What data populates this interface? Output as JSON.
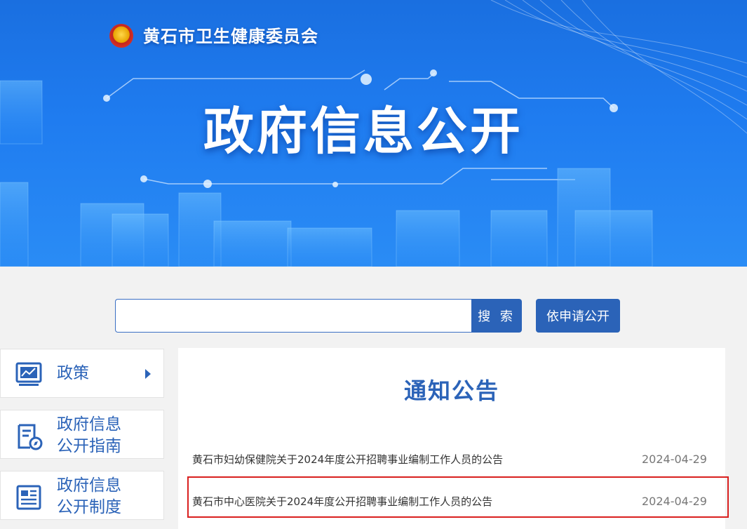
{
  "banner": {
    "org_name": "黄石市卫生健康委员会",
    "title": "政府信息公开"
  },
  "search": {
    "placeholder": "",
    "button_label": "搜 索",
    "apply_label": "依申请公开"
  },
  "sidebar": {
    "items": [
      {
        "label": "政策",
        "icon": "policy-chart-icon"
      },
      {
        "label": "政府信息\n公开指南",
        "icon": "guide-document-icon"
      },
      {
        "label": "政府信息\n公开制度",
        "icon": "system-document-icon"
      }
    ]
  },
  "main": {
    "title": "通知公告",
    "notices": [
      {
        "title": "黄石市妇幼保健院关于2024年度公开招聘事业编制工作人员的公告",
        "date": "2024-04-29"
      },
      {
        "title": "黄石市中心医院关于2024年度公开招聘事业编制工作人员的公告",
        "date": "2024-04-29"
      }
    ]
  },
  "colors": {
    "brand_blue": "#2b63b8",
    "banner_blue": "#1f7cf0",
    "highlight_red": "#d9201f"
  }
}
